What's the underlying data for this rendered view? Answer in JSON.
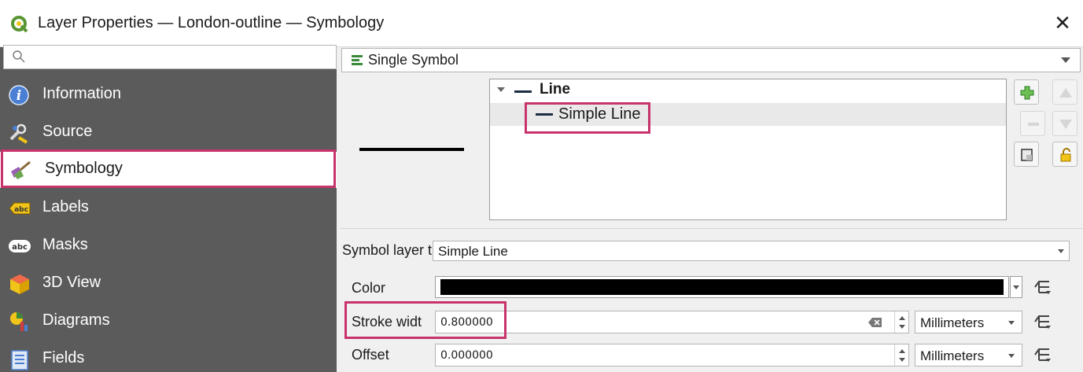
{
  "window": {
    "title": "Layer Properties — London-outline — Symbology",
    "close_symbol": "✕"
  },
  "sidebar": {
    "search_placeholder": "",
    "items": [
      {
        "label": "Information",
        "icon": "information-icon"
      },
      {
        "label": "Source",
        "icon": "source-icon"
      },
      {
        "label": "Symbology",
        "icon": "symbology-icon",
        "active": true
      },
      {
        "label": "Labels",
        "icon": "labels-icon"
      },
      {
        "label": "Masks",
        "icon": "masks-icon"
      },
      {
        "label": "3D View",
        "icon": "3d-view-icon"
      },
      {
        "label": "Diagrams",
        "icon": "diagrams-icon"
      },
      {
        "label": "Fields",
        "icon": "fields-icon"
      }
    ]
  },
  "renderer": {
    "selected": "Single Symbol"
  },
  "symbol_tree": {
    "parent_label": "Line",
    "child_label": "Simple Line"
  },
  "symbol_layer": {
    "type_label": "Symbol layer t",
    "type_value": "Simple Line",
    "color_label": "Color",
    "color_value": "#000000",
    "stroke_width_label": "Stroke widt",
    "stroke_width_value": "0.800000",
    "stroke_width_unit": "Millimeters",
    "offset_label": "Offset",
    "offset_value": "0.000000",
    "offset_unit": "Millimeters"
  },
  "colors": {
    "sidebar_bg": "#5b5b5b",
    "highlight": "#c8336b",
    "qgis_green": "#589632"
  }
}
